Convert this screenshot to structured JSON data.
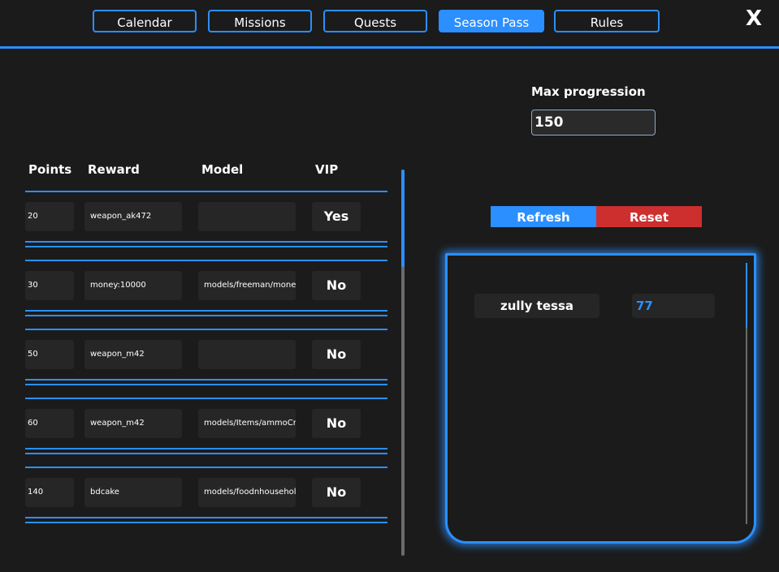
{
  "tabs": [
    {
      "label": "Calendar"
    },
    {
      "label": "Missions"
    },
    {
      "label": "Quests"
    },
    {
      "label": "Season Pass",
      "active": true
    },
    {
      "label": "Rules"
    }
  ],
  "close_label": "X",
  "max_progression": {
    "label": "Max progression",
    "value": "150"
  },
  "table": {
    "headers": {
      "points": "Points",
      "reward": "Reward",
      "model": "Model",
      "vip": "VIP"
    },
    "rows": [
      {
        "points": "20",
        "reward": "weapon_ak472",
        "model": "",
        "vip": "Yes"
      },
      {
        "points": "30",
        "reward": "money:10000",
        "model": "models/freeman/money",
        "vip": "No"
      },
      {
        "points": "50",
        "reward": "weapon_m42",
        "model": "",
        "vip": "No"
      },
      {
        "points": "60",
        "reward": "weapon_m42",
        "model": "models/Items/ammoCra",
        "vip": "No"
      },
      {
        "points": "140",
        "reward": "bdcake",
        "model": "models/foodnhouseholo",
        "vip": "No"
      }
    ]
  },
  "buttons": {
    "refresh": "Refresh",
    "reset": "Reset"
  },
  "players": [
    {
      "name": "zully tessa",
      "points": "77"
    }
  ],
  "colors": {
    "accent": "#2b8fff",
    "danger": "#cd2f2f",
    "background": "#1b1b1b",
    "cell": "#262626"
  }
}
